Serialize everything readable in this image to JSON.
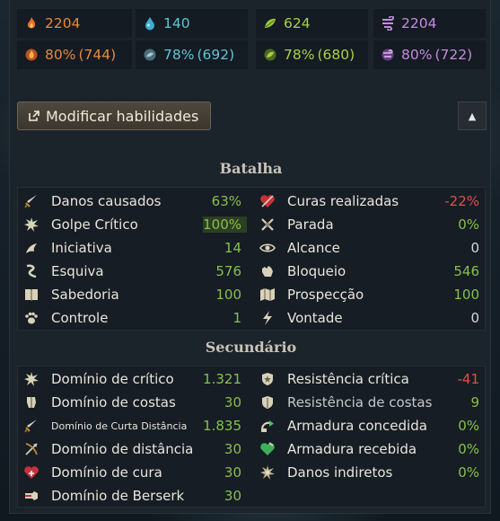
{
  "resources": {
    "row1": [
      {
        "icon": "fire-icon",
        "value": "2204",
        "color": "#e88a3a"
      },
      {
        "icon": "water-drop-icon",
        "value": "140",
        "color": "#5ec5d6"
      },
      {
        "icon": "leaf-icon",
        "value": "624",
        "color": "#a9d046"
      },
      {
        "icon": "wind-icon",
        "value": "2204",
        "color": "#c48ce0"
      }
    ],
    "row2": [
      {
        "icon": "fire-orb-icon",
        "value": "80%",
        "sub": "(744)",
        "color": "#e88a3a"
      },
      {
        "icon": "water-orb-icon",
        "value": "78%",
        "sub": "(692)",
        "color": "#5ec5d6"
      },
      {
        "icon": "earth-orb-icon",
        "value": "78%",
        "sub": "(680)",
        "color": "#a9d046"
      },
      {
        "icon": "air-orb-icon",
        "value": "80%",
        "sub": "(722)",
        "color": "#c48ce0"
      }
    ]
  },
  "toolbar": {
    "modify_label": "Modificar habilidades",
    "collapse_icon": "▲"
  },
  "batalha": {
    "title": "Batalha",
    "left": [
      {
        "icon": "sword-icon",
        "label": "Danos causados",
        "value": "63%"
      },
      {
        "icon": "critical-burst-icon",
        "label": "Golpe Crítico",
        "value": "100%"
      },
      {
        "icon": "initiative-icon",
        "label": "Iniciativa",
        "value": "14"
      },
      {
        "icon": "dodge-icon",
        "label": "Esquiva",
        "value": "576"
      },
      {
        "icon": "book-icon",
        "label": "Sabedoria",
        "value": "100"
      },
      {
        "icon": "paw-icon",
        "label": "Controle",
        "value": "1"
      }
    ],
    "right": [
      {
        "icon": "heart-icon",
        "label": "Curas realizadas",
        "value": "-22%"
      },
      {
        "icon": "parry-icon",
        "label": "Parada",
        "value": "0%"
      },
      {
        "icon": "eye-icon",
        "label": "Alcance",
        "value": "0"
      },
      {
        "icon": "block-icon",
        "label": "Bloqueio",
        "value": "546"
      },
      {
        "icon": "map-icon",
        "label": "Prospecção",
        "value": "100"
      },
      {
        "icon": "lightning-icon",
        "label": "Vontade",
        "value": "0"
      }
    ]
  },
  "secundario": {
    "title": "Secundário",
    "left": [
      {
        "icon": "critical-mastery-icon",
        "label": "Domínio de crítico",
        "value": "1.321"
      },
      {
        "icon": "back-mastery-icon",
        "label": "Domínio de costas",
        "value": "30"
      },
      {
        "icon": "melee-mastery-icon",
        "label": "Domínio de Curta Distância",
        "value": "1.835"
      },
      {
        "icon": "distance-mastery-icon",
        "label": "Domínio de distância",
        "value": "30"
      },
      {
        "icon": "heal-mastery-icon",
        "label": "Domínio de cura",
        "value": "30"
      },
      {
        "icon": "berserk-mastery-icon",
        "label": "Domínio de Berserk",
        "value": "30"
      }
    ],
    "right": [
      {
        "icon": "critical-resistance-icon",
        "label": "Resistência crítica",
        "value": "-41"
      },
      {
        "icon": "back-resistance-icon",
        "label": "Resistência de costas",
        "value": "9"
      },
      {
        "icon": "armor-given-icon",
        "label": "Armadura concedida",
        "value": "0%"
      },
      {
        "icon": "armor-received-icon",
        "label": "Armadura recebida",
        "value": "0%"
      },
      {
        "icon": "indirect-damage-icon",
        "label": "Danos indiretos",
        "value": "0%"
      }
    ]
  }
}
